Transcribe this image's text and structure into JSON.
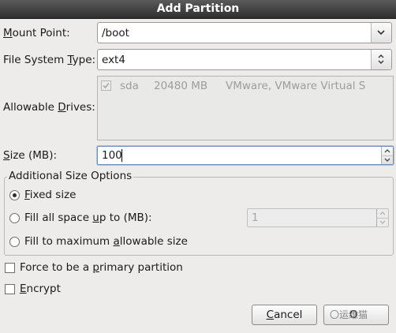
{
  "dialog": {
    "title": "Add Partition"
  },
  "mount_point": {
    "label_pre": "",
    "label_key": "M",
    "label_post": "ount Point:",
    "value": "/boot",
    "dropdown_icon": "chevron-down-icon"
  },
  "fs_type": {
    "label_pre": "File System ",
    "label_key": "T",
    "label_post": "ype:",
    "value": "ext4",
    "dropdown_icon": "up-down-chevron-icon"
  },
  "allowable_drives": {
    "label_pre": "Allowable ",
    "label_key": "D",
    "label_post": "rives:",
    "drives": [
      {
        "checked": true,
        "name": "sda",
        "size": "20480 MB",
        "model": "VMware, VMware Virtual S"
      }
    ]
  },
  "size": {
    "label_pre": "",
    "label_key": "S",
    "label_post": "ize (MB):",
    "value": "100"
  },
  "additional_size_options": {
    "legend": "Additional Size Options",
    "options": [
      {
        "pre": "",
        "key": "F",
        "post": "ixed size",
        "selected": true
      },
      {
        "pre": "Fill all space ",
        "key": "u",
        "post": "p to (MB):",
        "selected": false
      },
      {
        "pre": "Fill to maximum ",
        "key": "a",
        "post": "llowable size",
        "selected": false
      }
    ],
    "fill_up_to_value": "1"
  },
  "force_primary": {
    "pre": "Force to be a ",
    "key": "p",
    "post": "rimary partition",
    "checked": false
  },
  "encrypt": {
    "pre": "",
    "key": "E",
    "post": "ncrypt",
    "checked": false
  },
  "buttons": {
    "cancel_key": "C",
    "cancel_post": "ancel",
    "ok_visible": "O"
  },
  "watermark": {
    "text": "〇运维猫"
  }
}
